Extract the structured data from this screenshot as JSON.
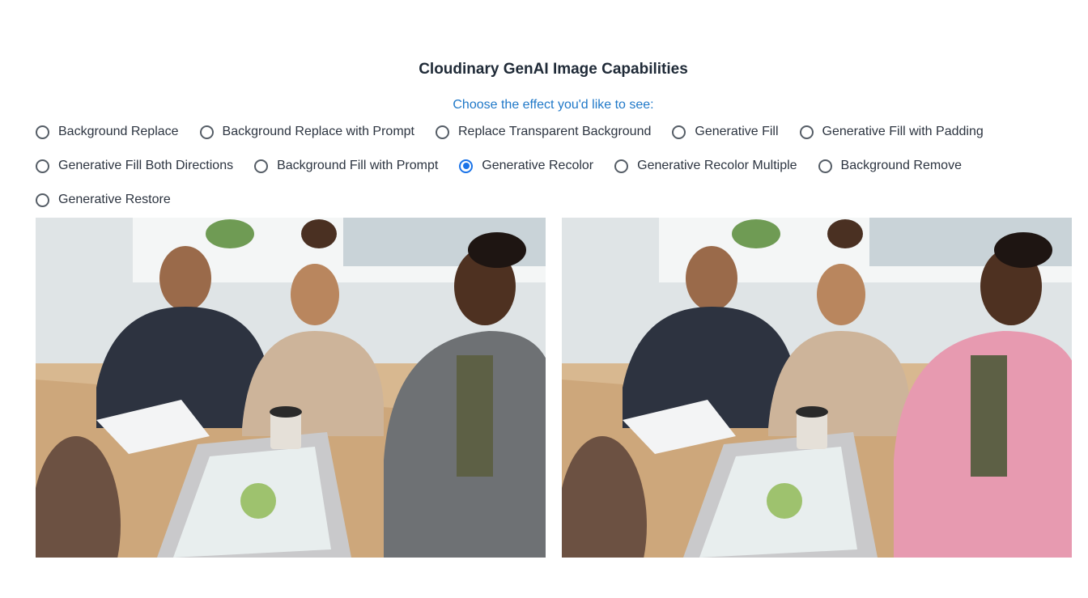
{
  "header": {
    "title": "Cloudinary GenAI Image Capabilities"
  },
  "prompt": "Choose the effect you'd like to see:",
  "effects": {
    "selected": "Generative Recolor",
    "rows": [
      [
        "Background Replace",
        "Background Replace with Prompt",
        "Replace Transparent Background",
        "Generative Fill",
        "Generative Fill with Padding"
      ],
      [
        "Generative Fill Both Directions",
        "Background Fill with Prompt",
        "Generative Recolor",
        "Generative Recolor Multiple",
        "Background Remove"
      ],
      [
        "Generative Restore"
      ]
    ]
  },
  "images": {
    "original": {
      "jacket_color": "#6e7174"
    },
    "recolored": {
      "jacket_color": "#e79ab0"
    }
  }
}
